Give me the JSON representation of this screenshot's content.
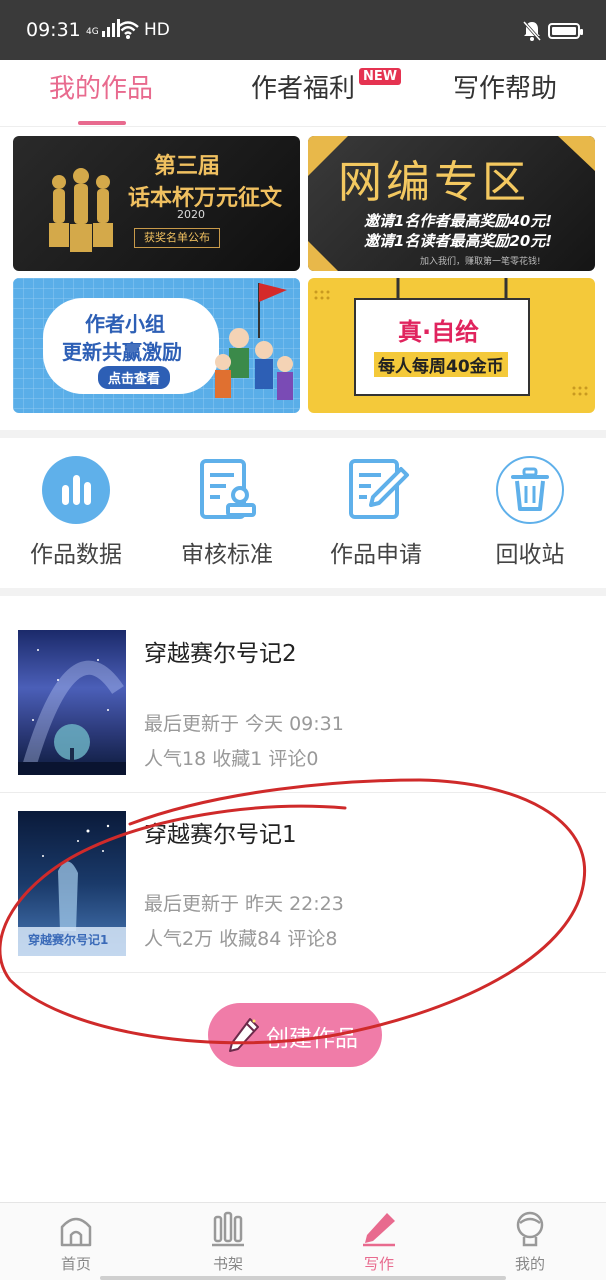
{
  "status_bar": {
    "time": "09:31",
    "network": "4G",
    "hd": "HD"
  },
  "tabs": {
    "mine": "我的作品",
    "welfare": "作者福利",
    "help": "写作帮助",
    "new_badge": "NEW"
  },
  "banners": [
    {
      "title1": "第三届",
      "title2": "话本杯万元征文",
      "year": "2020",
      "button": "获奖名单公布"
    },
    {
      "title": "网编专区",
      "line1": "邀请1名作者最高奖励40元!",
      "line2": "邀请1名读者最高奖励20元!",
      "footer": "加入我们，赚取第一笔零花钱!"
    },
    {
      "line1": "作者小组",
      "line2": "更新共赢激励",
      "button": "点击查看"
    },
    {
      "line1": "真·自给",
      "line2": "每人每周40金币"
    }
  ],
  "actions": [
    {
      "label": "作品数据",
      "icon": "bar-chart-icon"
    },
    {
      "label": "审核标准",
      "icon": "review-document-icon"
    },
    {
      "label": "作品申请",
      "icon": "edit-document-icon"
    },
    {
      "label": "回收站",
      "icon": "trash-icon"
    }
  ],
  "works": [
    {
      "title": "穿越赛尔号记2",
      "updated": "最后更新于 今天 09:31",
      "stats": "人气18 收藏1 评论0"
    },
    {
      "title": "穿越赛尔号记1",
      "updated": "最后更新于 昨天 22:23",
      "stats": "人气2万 收藏84 评论8",
      "cover_text": "穿越赛尔号记1"
    }
  ],
  "create_button": "创建作品",
  "bottom_nav": [
    {
      "label": "首页",
      "icon": "home-icon"
    },
    {
      "label": "书架",
      "icon": "bookshelf-icon"
    },
    {
      "label": "写作",
      "icon": "pen-icon"
    },
    {
      "label": "我的",
      "icon": "profile-icon"
    }
  ],
  "colors": {
    "accent": "#e86a8e",
    "create_button": "#f07ca8",
    "icon_blue": "#5fb0ea",
    "annotation_red": "#d02020"
  }
}
